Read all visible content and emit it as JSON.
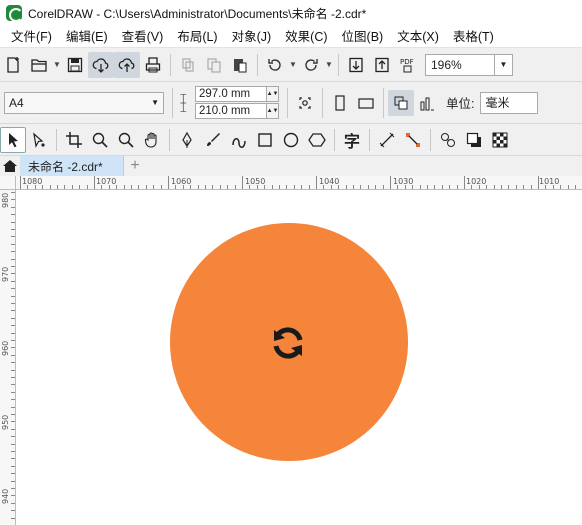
{
  "window": {
    "title": "CorelDRAW - C:\\Users\\Administrator\\Documents\\未命名 -2.cdr*"
  },
  "menu": {
    "items": [
      "文件(F)",
      "编辑(E)",
      "查看(V)",
      "布局(L)",
      "对象(J)",
      "效果(C)",
      "位图(B)",
      "文本(X)",
      "表格(T)"
    ]
  },
  "toolbar": {
    "zoom_value": "196%",
    "pdf_label": "PDF"
  },
  "property_bar": {
    "paper_size": "A4",
    "width": "297.0 mm",
    "height": "210.0 mm",
    "unit_label": "单位:",
    "unit_value": "毫米"
  },
  "toolbox": {
    "text_tool_glyph": "字"
  },
  "tabs": {
    "document": "未命名 -2.cdr*"
  },
  "ruler": {
    "horizontal_labels": [
      "1080",
      "1070",
      "1060",
      "1050",
      "1040",
      "1030",
      "1020",
      "1010"
    ],
    "vertical_labels": [
      "980",
      "970",
      "960",
      "950",
      "940"
    ]
  },
  "canvas": {
    "circle_color": "#f5853a",
    "icon_color": "#1a1a1a",
    "icon_name": "sync-icon"
  }
}
